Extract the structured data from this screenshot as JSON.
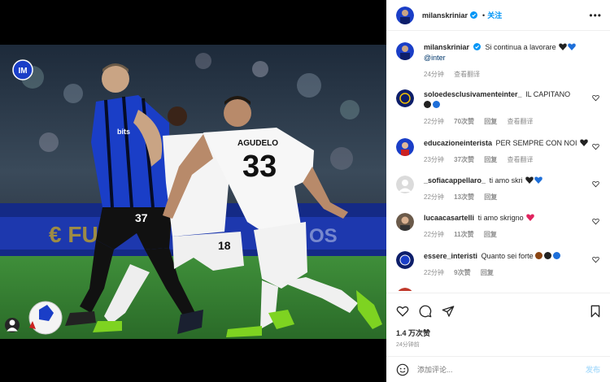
{
  "header": {
    "username": "milanskriniar",
    "follow_label": "关注",
    "more_icon": "more-horizontal-icon"
  },
  "caption": {
    "username": "milanskriniar",
    "text": "Si continua a lavorare",
    "mention": "@inter",
    "time": "24分钟",
    "translate": "查看翻译"
  },
  "comments": [
    {
      "username": "soloedesclusivamenteinter_",
      "text": "IL CAPITANO",
      "time": "22分钟",
      "likes": "70次赞",
      "reply": "回复",
      "translate": "查看翻译"
    },
    {
      "username": "educazioneinterista",
      "text": "PER SEMPRE CON NOI",
      "time": "23分钟",
      "likes": "37次赞",
      "reply": "回复",
      "translate": "查看翻译"
    },
    {
      "username": "_sofiacappellaro_",
      "text": "ti amo skri",
      "time": "22分钟",
      "likes": "13次赞",
      "reply": "回复"
    },
    {
      "username": "lucaacasartelli",
      "text": "ti amo skrigno",
      "time": "22分钟",
      "likes": "11次赞",
      "reply": "回复"
    },
    {
      "username": "essere_interisti",
      "text": "Quanto sei forte",
      "time": "22分钟",
      "likes": "9次赞",
      "reply": "回复"
    }
  ],
  "actions": {
    "likes": "1.4 万次赞",
    "time": "24分钟前"
  },
  "compose": {
    "placeholder": "添加评论...",
    "post_label": "发布"
  },
  "photo": {
    "badge_text": "INTER",
    "player_numbers": [
      "37",
      "18",
      "33"
    ],
    "sponsor_text": "Digitalbits",
    "opponent_name": "AGUDELO"
  },
  "colors": {
    "accent": "#0095f6",
    "inter_blue": "#1a3ec7",
    "pitch": "#2e7d32"
  }
}
